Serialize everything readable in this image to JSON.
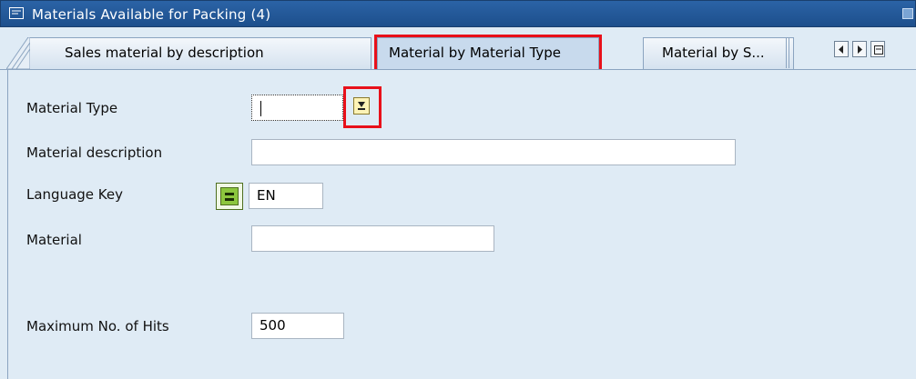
{
  "window": {
    "title": "Materials Available for Packing (4)"
  },
  "tabs": [
    {
      "label": "Sales material by description",
      "active": false
    },
    {
      "label": "Material by Material Type",
      "active": true
    },
    {
      "label": "Material by S...",
      "active": false
    }
  ],
  "form": {
    "material_type": {
      "label": "Material Type",
      "value": ""
    },
    "material_description": {
      "label": "Material description",
      "value": ""
    },
    "language_key": {
      "label": "Language Key",
      "value": "EN"
    },
    "material": {
      "label": "Material",
      "value": ""
    },
    "max_hits": {
      "label": "Maximum No. of Hits",
      "value": "500"
    }
  },
  "colors": {
    "highlight": "#e8101a",
    "titlebar": "#1d4f8c",
    "background": "#dfebf5"
  },
  "icons": [
    "window-menu-icon",
    "value-help-icon",
    "equals-option-icon",
    "scroll-left-icon",
    "scroll-right-icon",
    "tab-list-icon"
  ]
}
